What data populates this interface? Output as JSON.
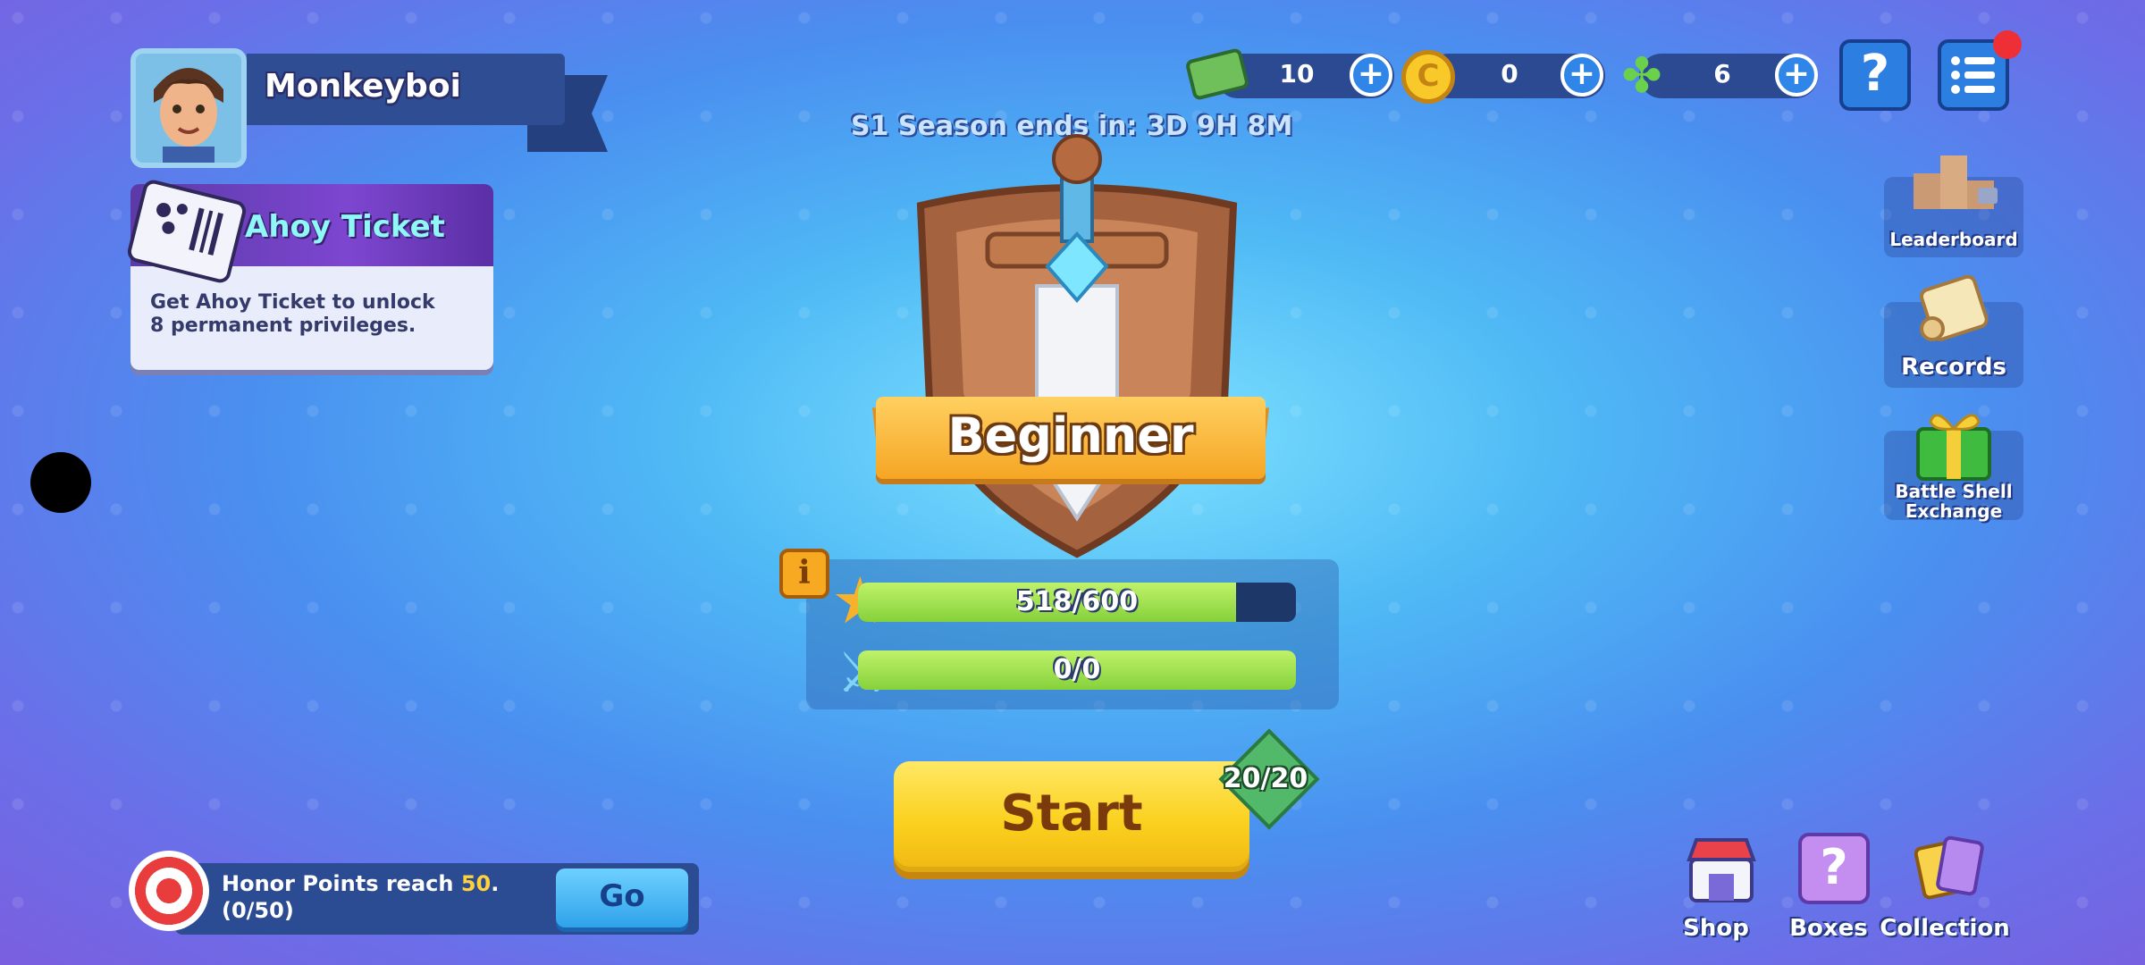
{
  "player": {
    "name": "Monkeyboi"
  },
  "ticket": {
    "title": "Ahoy Ticket",
    "description_line1": "Get Ahoy Ticket to unlock",
    "description_line2": "8 permanent privileges."
  },
  "currencies": {
    "cash": "10",
    "coins": "0",
    "clover": "6",
    "coin_symbol": "C",
    "plus": "+"
  },
  "top_buttons": {
    "help": "?"
  },
  "season": {
    "text": "S1 Season ends in: 3D 9H 8M"
  },
  "rank": {
    "name": "Beginner"
  },
  "progress": {
    "honor_text": "518/600",
    "honor_fraction": 0.8633,
    "battle_text": "0/0",
    "battle_fraction": 1.0,
    "info_symbol": "i"
  },
  "side_menu": {
    "leaderboard": "Leaderboard",
    "records": "Records",
    "battle_shell_1": "Battle Shell",
    "battle_shell_2": "Exchange"
  },
  "start": {
    "label": "Start",
    "energy": "20/20"
  },
  "quest": {
    "prefix": "Honor Points reach ",
    "target": "50",
    "suffix": ".",
    "progress": "(0/50)",
    "go_label": "Go",
    "target_color": "#ffd13a"
  },
  "bottom_nav": {
    "shop": "Shop",
    "boxes": "Boxes",
    "collection": "Collection",
    "boxes_symbol": "?"
  },
  "colors": {
    "accent_yellow": "#fbd11e",
    "progress_green": "#86d13b",
    "panel_blue": "#2c4a92"
  }
}
